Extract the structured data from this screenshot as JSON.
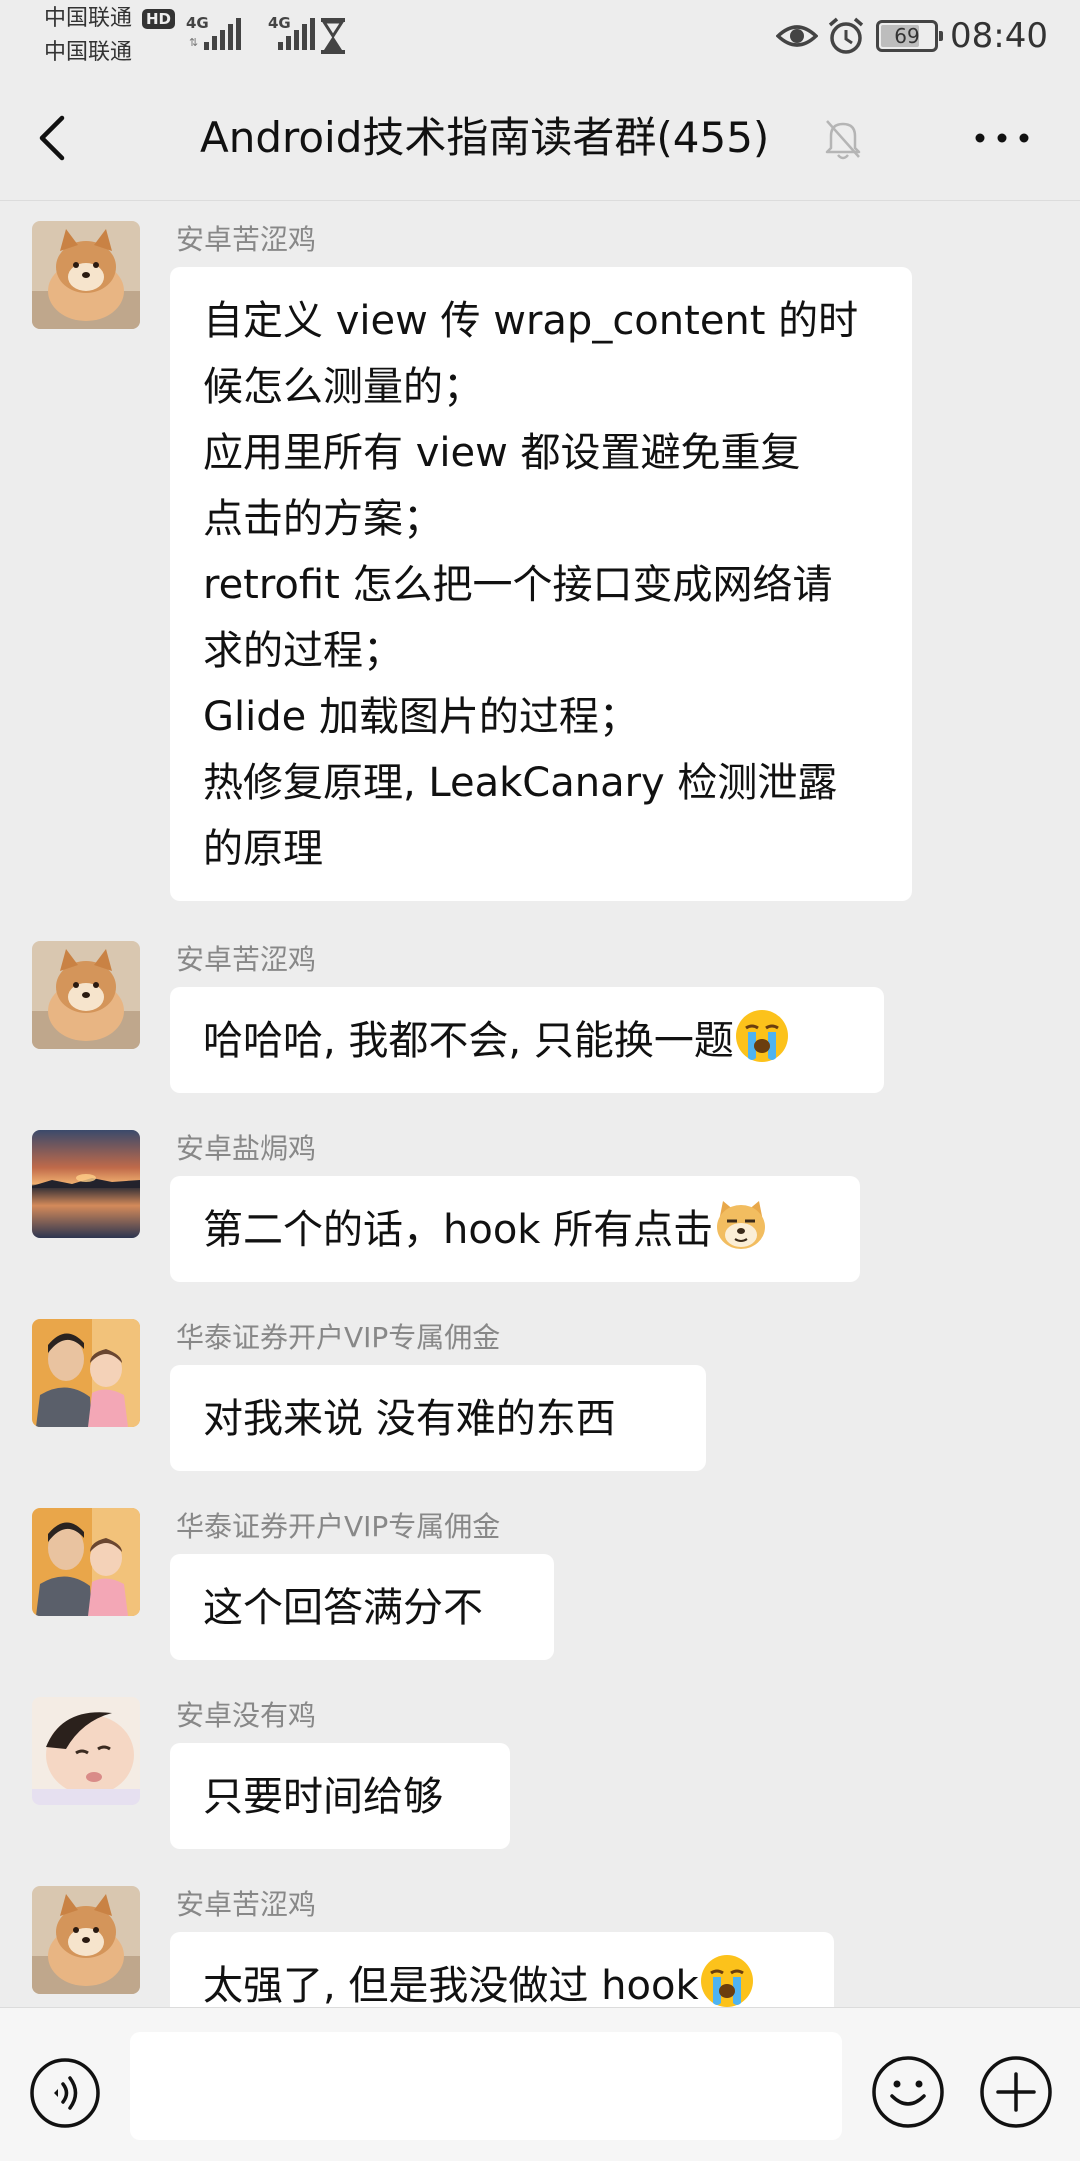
{
  "status_bar": {
    "carrier_1": "中国联通",
    "carrier_2": "中国联通",
    "hd_label": "HD",
    "network_1": "4G",
    "network_2": "4G",
    "battery_level": "69",
    "time": "08:40"
  },
  "header": {
    "title": "Android技术指南读者群(455)",
    "back_icon": "chevron-left-icon",
    "mute_icon": "bell-off-icon",
    "more_icon": "more-horizontal-icon"
  },
  "messages": [
    {
      "sender": "安卓苦涩鸡",
      "avatar": "shiba-dog-photo",
      "lines": [
        "自定义 view 传 wrap_content 的时",
        "候怎么测量的；",
        "应用里所有 view 都设置避免重复",
        "点击的方案；",
        "retrofit 怎么把一个接口变成网络请",
        "求的过程；",
        "Glide 加载图片的过程；",
        "热修复原理, LeakCanary 检测泄露",
        "的原理"
      ]
    },
    {
      "sender": "安卓苦涩鸡",
      "avatar": "shiba-dog-photo",
      "text": "哈哈哈, 我都不会, 只能换一题",
      "emoji": "crying-face"
    },
    {
      "sender": "安卓盐焗鸡",
      "avatar": "sunset-lake-photo",
      "text": "第二个的话，hook 所有点击",
      "emoji": "doge-face"
    },
    {
      "sender": "华泰证券开户VIP专属佣金",
      "avatar": "father-daughter-photo",
      "text": "对我来说 没有难的东西"
    },
    {
      "sender": "华泰证券开户VIP专属佣金",
      "avatar": "father-daughter-photo",
      "text": "这个回答满分不"
    },
    {
      "sender": "安卓没有鸡",
      "avatar": "baby-face-photo",
      "text": "只要时间给够"
    },
    {
      "sender": "安卓苦涩鸡",
      "avatar": "shiba-dog-photo",
      "text": "太强了, 但是我没做过 hook",
      "emoji": "crying-face"
    }
  ],
  "input_bar": {
    "voice_icon": "voice-icon",
    "input_value": "",
    "emoji_icon": "smiley-icon",
    "plus_icon": "plus-circle-icon"
  },
  "colors": {
    "background": "#ededed",
    "bubble": "#ffffff",
    "sender_name": "#888888",
    "input_bar": "#f6f6f6"
  }
}
